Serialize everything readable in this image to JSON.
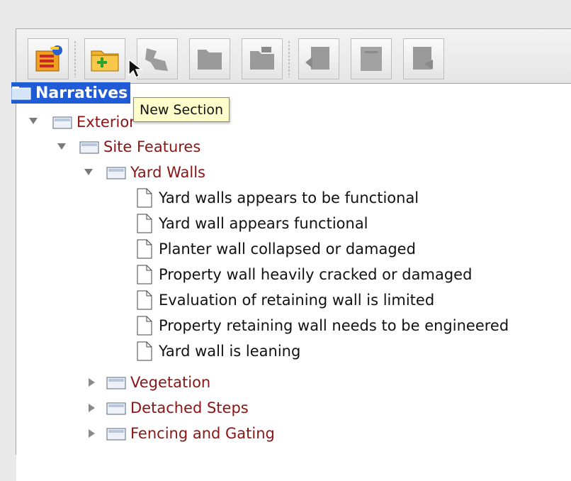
{
  "toolbar": {
    "buttons": [
      {
        "name": "new-narrative-button",
        "icon": "new-narrative-icon",
        "enabled": true
      },
      {
        "name": "new-section-button",
        "icon": "new-section-icon",
        "enabled": true
      },
      {
        "name": "cut-button",
        "icon": "cut-icon",
        "enabled": false
      },
      {
        "name": "copy-button",
        "icon": "copy-icon",
        "enabled": false
      },
      {
        "name": "paste-button",
        "icon": "paste-icon",
        "enabled": false
      },
      {
        "name": "move-left-button",
        "icon": "move-left-icon",
        "enabled": false
      },
      {
        "name": "edit-button",
        "icon": "edit-icon",
        "enabled": false
      },
      {
        "name": "move-right-button",
        "icon": "move-right-icon",
        "enabled": false
      }
    ]
  },
  "tooltip": {
    "text": "New Section"
  },
  "tree": {
    "root": "Narratives",
    "exterior": "Exterior",
    "site_features": "Site Features",
    "yard_walls": "Yard Walls",
    "narratives": [
      "Yard walls appears to be functional",
      "Yard wall appears functional",
      "Planter wall collapsed or damaged",
      "Property wall heavily cracked or damaged",
      "Evaluation of retaining wall is limited",
      "Property retaining wall needs to be engineered",
      "Yard wall is leaning"
    ],
    "collapsed_sections": [
      "Vegetation",
      "Detached Steps",
      "Fencing and Gating"
    ]
  },
  "colors": {
    "selection": "#1f5bd6",
    "folder_label": "#8b1414",
    "tooltip_bg": "#ffffcc"
  }
}
